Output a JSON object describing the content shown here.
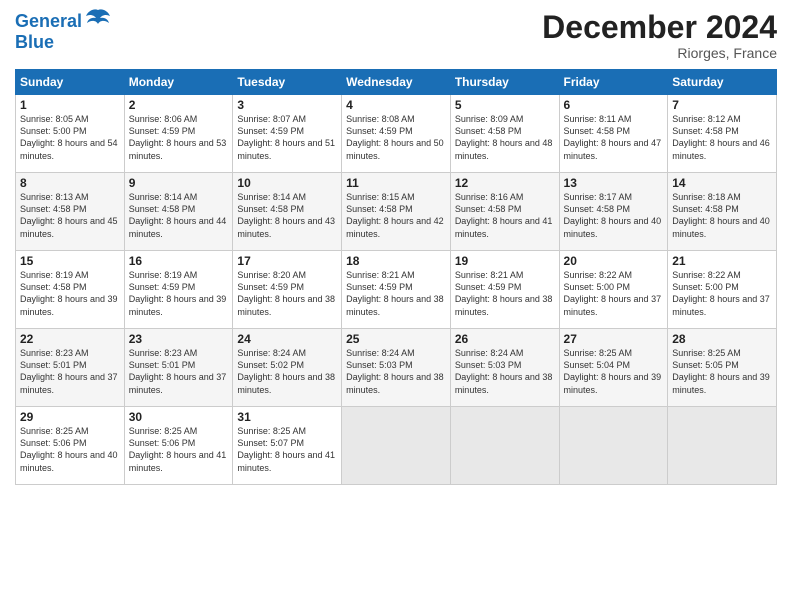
{
  "header": {
    "logo_line1": "General",
    "logo_line2": "Blue",
    "month_title": "December 2024",
    "location": "Riorges, France"
  },
  "days_header": [
    "Sunday",
    "Monday",
    "Tuesday",
    "Wednesday",
    "Thursday",
    "Friday",
    "Saturday"
  ],
  "weeks": [
    [
      {
        "day": "1",
        "sunrise": "8:05 AM",
        "sunset": "5:00 PM",
        "daylight": "8 hours and 54 minutes."
      },
      {
        "day": "2",
        "sunrise": "8:06 AM",
        "sunset": "4:59 PM",
        "daylight": "8 hours and 53 minutes."
      },
      {
        "day": "3",
        "sunrise": "8:07 AM",
        "sunset": "4:59 PM",
        "daylight": "8 hours and 51 minutes."
      },
      {
        "day": "4",
        "sunrise": "8:08 AM",
        "sunset": "4:59 PM",
        "daylight": "8 hours and 50 minutes."
      },
      {
        "day": "5",
        "sunrise": "8:09 AM",
        "sunset": "4:58 PM",
        "daylight": "8 hours and 48 minutes."
      },
      {
        "day": "6",
        "sunrise": "8:11 AM",
        "sunset": "4:58 PM",
        "daylight": "8 hours and 47 minutes."
      },
      {
        "day": "7",
        "sunrise": "8:12 AM",
        "sunset": "4:58 PM",
        "daylight": "8 hours and 46 minutes."
      }
    ],
    [
      {
        "day": "8",
        "sunrise": "8:13 AM",
        "sunset": "4:58 PM",
        "daylight": "8 hours and 45 minutes."
      },
      {
        "day": "9",
        "sunrise": "8:14 AM",
        "sunset": "4:58 PM",
        "daylight": "8 hours and 44 minutes."
      },
      {
        "day": "10",
        "sunrise": "8:14 AM",
        "sunset": "4:58 PM",
        "daylight": "8 hours and 43 minutes."
      },
      {
        "day": "11",
        "sunrise": "8:15 AM",
        "sunset": "4:58 PM",
        "daylight": "8 hours and 42 minutes."
      },
      {
        "day": "12",
        "sunrise": "8:16 AM",
        "sunset": "4:58 PM",
        "daylight": "8 hours and 41 minutes."
      },
      {
        "day": "13",
        "sunrise": "8:17 AM",
        "sunset": "4:58 PM",
        "daylight": "8 hours and 40 minutes."
      },
      {
        "day": "14",
        "sunrise": "8:18 AM",
        "sunset": "4:58 PM",
        "daylight": "8 hours and 40 minutes."
      }
    ],
    [
      {
        "day": "15",
        "sunrise": "8:19 AM",
        "sunset": "4:58 PM",
        "daylight": "8 hours and 39 minutes."
      },
      {
        "day": "16",
        "sunrise": "8:19 AM",
        "sunset": "4:59 PM",
        "daylight": "8 hours and 39 minutes."
      },
      {
        "day": "17",
        "sunrise": "8:20 AM",
        "sunset": "4:59 PM",
        "daylight": "8 hours and 38 minutes."
      },
      {
        "day": "18",
        "sunrise": "8:21 AM",
        "sunset": "4:59 PM",
        "daylight": "8 hours and 38 minutes."
      },
      {
        "day": "19",
        "sunrise": "8:21 AM",
        "sunset": "4:59 PM",
        "daylight": "8 hours and 38 minutes."
      },
      {
        "day": "20",
        "sunrise": "8:22 AM",
        "sunset": "5:00 PM",
        "daylight": "8 hours and 37 minutes."
      },
      {
        "day": "21",
        "sunrise": "8:22 AM",
        "sunset": "5:00 PM",
        "daylight": "8 hours and 37 minutes."
      }
    ],
    [
      {
        "day": "22",
        "sunrise": "8:23 AM",
        "sunset": "5:01 PM",
        "daylight": "8 hours and 37 minutes."
      },
      {
        "day": "23",
        "sunrise": "8:23 AM",
        "sunset": "5:01 PM",
        "daylight": "8 hours and 37 minutes."
      },
      {
        "day": "24",
        "sunrise": "8:24 AM",
        "sunset": "5:02 PM",
        "daylight": "8 hours and 38 minutes."
      },
      {
        "day": "25",
        "sunrise": "8:24 AM",
        "sunset": "5:03 PM",
        "daylight": "8 hours and 38 minutes."
      },
      {
        "day": "26",
        "sunrise": "8:24 AM",
        "sunset": "5:03 PM",
        "daylight": "8 hours and 38 minutes."
      },
      {
        "day": "27",
        "sunrise": "8:25 AM",
        "sunset": "5:04 PM",
        "daylight": "8 hours and 39 minutes."
      },
      {
        "day": "28",
        "sunrise": "8:25 AM",
        "sunset": "5:05 PM",
        "daylight": "8 hours and 39 minutes."
      }
    ],
    [
      {
        "day": "29",
        "sunrise": "8:25 AM",
        "sunset": "5:06 PM",
        "daylight": "8 hours and 40 minutes."
      },
      {
        "day": "30",
        "sunrise": "8:25 AM",
        "sunset": "5:06 PM",
        "daylight": "8 hours and 41 minutes."
      },
      {
        "day": "31",
        "sunrise": "8:25 AM",
        "sunset": "5:07 PM",
        "daylight": "8 hours and 41 minutes."
      },
      null,
      null,
      null,
      null
    ]
  ],
  "labels": {
    "sunrise": "Sunrise:",
    "sunset": "Sunset:",
    "daylight": "Daylight:"
  }
}
